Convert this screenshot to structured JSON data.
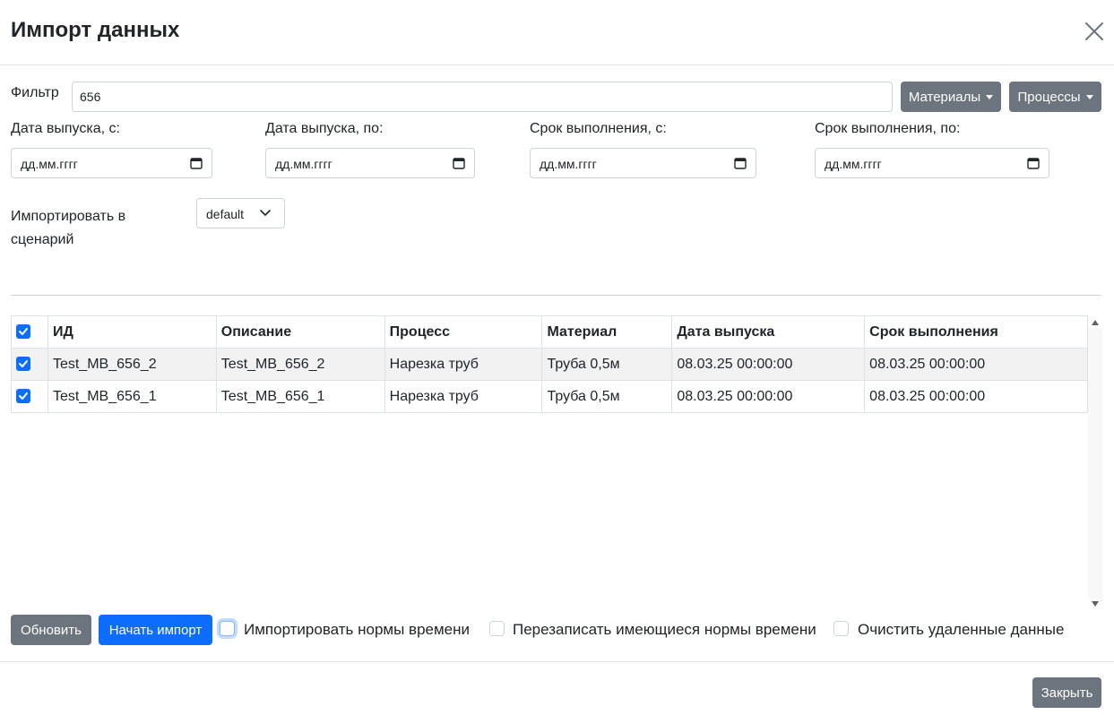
{
  "dialog": {
    "title": "Импорт данных"
  },
  "filter": {
    "label": "Фильтр",
    "value": "656",
    "materials_label": "Материалы",
    "processes_label": "Процессы"
  },
  "dates": {
    "release_from_label": "Дата выпуска, с:",
    "release_to_label": "Дата выпуска, по:",
    "due_from_label": "Срок выполнения, с:",
    "due_to_label": "Срок выполнения, по:",
    "placeholder": "дд.мм.гггг"
  },
  "scenario": {
    "label_line1": "Импортировать в",
    "label_line2": "сценарий",
    "selected": "default"
  },
  "table": {
    "columns": [
      "ИД",
      "Описание",
      "Процесс",
      "Материал",
      "Дата выпуска",
      "Срок выполнения"
    ],
    "rows": [
      {
        "id": "Test_MB_656_2",
        "description": "Test_MB_656_2",
        "process": "Нарезка труб",
        "material": "Труба 0,5м",
        "release": "08.03.25 00:00:00",
        "due": "08.03.25 00:00:00",
        "checked": true
      },
      {
        "id": "Test_MB_656_1",
        "description": "Test_MB_656_1",
        "process": "Нарезка труб",
        "material": "Труба 0,5м",
        "release": "08.03.25 00:00:00",
        "due": "08.03.25 00:00:00",
        "checked": true
      }
    ]
  },
  "actions": {
    "refresh_label": "Обновить",
    "start_import_label": "Начать импорт",
    "import_norms_label": "Импортировать нормы времени",
    "overwrite_norms_label": "Перезаписать имеющиеся нормы времени",
    "clear_deleted_label": "Очистить удаленные данные",
    "close_label": "Закрыть"
  },
  "icons": {
    "close": "close-icon",
    "calendar": "calendar-icon",
    "chevron": "chevron-down-icon",
    "check": "check-icon"
  },
  "colors": {
    "primary": "#0d6efd",
    "secondary": "#6c757d"
  }
}
